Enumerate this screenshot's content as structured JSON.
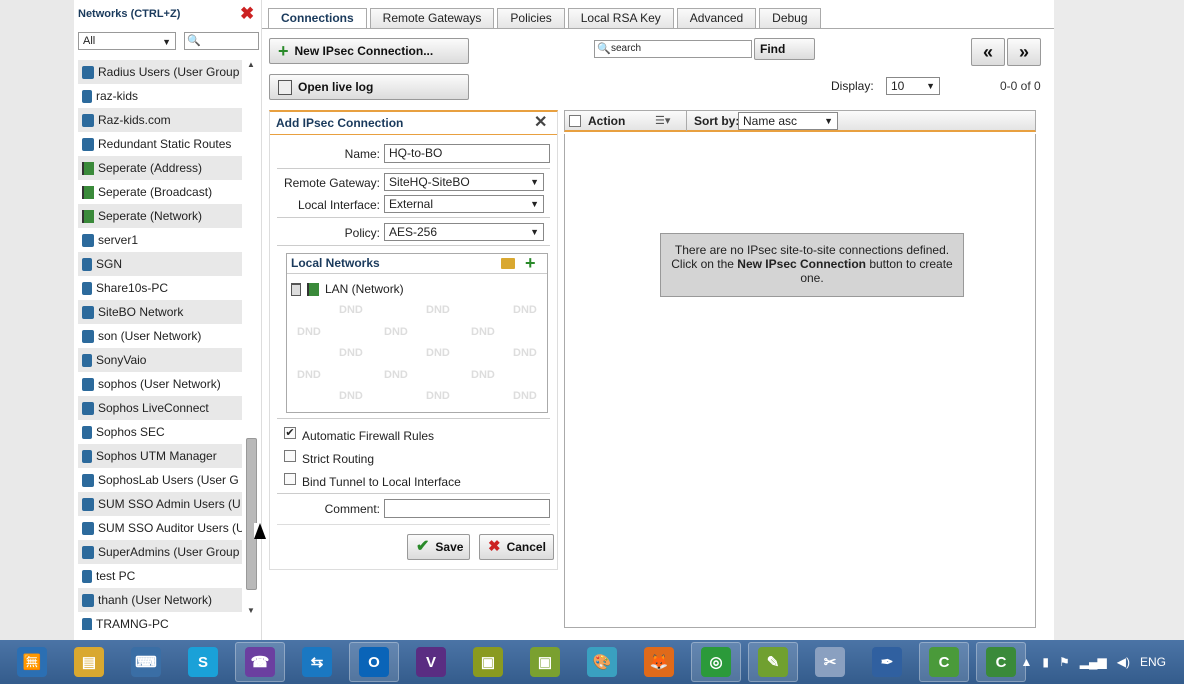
{
  "sidebar": {
    "title": "Networks (CTRL+Z)",
    "filter": "All",
    "search_placeholder": "",
    "items": [
      {
        "label": "Radius Users (User Group",
        "icon": "net"
      },
      {
        "label": "raz-kids",
        "icon": "host"
      },
      {
        "label": "Raz-kids.com",
        "icon": "net"
      },
      {
        "label": "Redundant Static Routes",
        "icon": "net"
      },
      {
        "label": "Seperate (Address)",
        "icon": "flag"
      },
      {
        "label": "Seperate (Broadcast)",
        "icon": "flag"
      },
      {
        "label": "Seperate (Network)",
        "icon": "flag"
      },
      {
        "label": "server1",
        "icon": "net"
      },
      {
        "label": "SGN",
        "icon": "host"
      },
      {
        "label": "Share10s-PC",
        "icon": "host"
      },
      {
        "label": "SiteBO Network",
        "icon": "net"
      },
      {
        "label": "son (User Network)",
        "icon": "net"
      },
      {
        "label": "SonyVaio",
        "icon": "host"
      },
      {
        "label": "sophos (User Network)",
        "icon": "net"
      },
      {
        "label": "Sophos LiveConnect",
        "icon": "net"
      },
      {
        "label": "Sophos SEC",
        "icon": "host"
      },
      {
        "label": "Sophos UTM Manager",
        "icon": "host"
      },
      {
        "label": "SophosLab Users (User G",
        "icon": "net"
      },
      {
        "label": "SUM SSO Admin Users (U",
        "icon": "net"
      },
      {
        "label": "SUM SSO Auditor Users (U",
        "icon": "net"
      },
      {
        "label": "SuperAdmins (User Group",
        "icon": "net"
      },
      {
        "label": "test PC",
        "icon": "host"
      },
      {
        "label": "thanh (User Network)",
        "icon": "net"
      },
      {
        "label": "TRAMNG-PC",
        "icon": "host"
      }
    ]
  },
  "tabs": [
    "Connections",
    "Remote Gateways",
    "Policies",
    "Local RSA Key",
    "Advanced",
    "Debug"
  ],
  "toolbar": {
    "new_label": "New IPsec Connection...",
    "log_label": "Open live log",
    "search_value": "search",
    "find_label": "Find",
    "prev_label": "«",
    "next_label": "»",
    "display_label": "Display:",
    "display_value": "10",
    "count": "0-0 of 0"
  },
  "dialog": {
    "title": "Add IPsec Connection",
    "name_label": "Name:",
    "name_value": "HQ-to-BO",
    "gateway_label": "Remote Gateway:",
    "gateway_value": "SiteHQ-SiteBO",
    "interface_label": "Local Interface:",
    "interface_value": "External",
    "policy_label": "Policy:",
    "policy_value": "AES-256",
    "local_networks_title": "Local Networks",
    "local_networks": [
      "LAN (Network)"
    ],
    "dnd": "DND",
    "auto_fw_label": "Automatic Firewall Rules",
    "auto_fw_checked": true,
    "strict_label": "Strict Routing",
    "strict_checked": false,
    "bind_label": "Bind Tunnel to Local Interface",
    "bind_checked": false,
    "comment_label": "Comment:",
    "comment_value": "",
    "save_label": "Save",
    "cancel_label": "Cancel"
  },
  "list": {
    "action_label": "Action",
    "sort_label": "Sort by:",
    "sort_value": "Name asc",
    "empty_line1": "There are no IPsec site-to-site connections defined.",
    "empty_line2a": "Click on the ",
    "empty_bold": "New IPsec Connection",
    "empty_line2b": " button to create one."
  },
  "taskbar": {
    "apps": [
      "language-icon",
      "explorer-icon",
      "network-icon",
      "skype-icon",
      "viber-icon",
      "teamviewer-icon",
      "outlook-icon",
      "visio-icon",
      "vmware-icon",
      "vmware-workstation-icon",
      "paint-icon",
      "firefox-icon",
      "chrome-icon",
      "notepad-icon",
      "snipping-icon",
      "pen-icon",
      "camtasia-icon",
      "camtasia-recorder-icon"
    ],
    "lang": "ENG"
  }
}
